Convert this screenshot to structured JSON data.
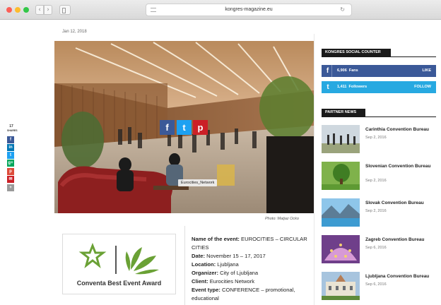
{
  "browser": {
    "url": "kongres-magazine.eu"
  },
  "left_share": {
    "count": "17",
    "count_label": "SHARES",
    "buttons": [
      "f",
      "in",
      "t",
      "g+",
      "p",
      "✉"
    ]
  },
  "article": {
    "date": "Jan 12, 2018",
    "image_tag": "Eurocities_Network",
    "photo_credit": "Photo: Matjaz Ocko",
    "share_buttons": [
      "f",
      "t",
      "p"
    ],
    "award": {
      "label": "Conventa Best Event Award"
    },
    "details": {
      "event_label": "Name of the event:",
      "event_value": " EUROCITIES – CIRCULAR CITIES",
      "date_label": "Date:",
      "date_value": " November 15 – 17, 2017",
      "location_label": "Location:",
      "location_value": " Ljubljana",
      "organizer_label": "Organizer:",
      "organizer_value": " City of Ljubljana",
      "client_label": "Client:",
      "client_value": " Eurocities Network",
      "type_label": "Event type:",
      "type_value": " CONFERENCE – promotional, educational"
    }
  },
  "sidebar": {
    "social_title": "KONGRES SOCIAL COUNTER",
    "facebook": {
      "count": "6,906",
      "unit": "Fans",
      "action": "LIKE"
    },
    "twitter": {
      "count": "1,411",
      "unit": "Followers",
      "action": "FOLLOW"
    },
    "partner_title": "PARTNER NEWS",
    "news": [
      {
        "title": "Carinthia Convention Bureau",
        "date": "Sep 2, 2016"
      },
      {
        "title": "Slovenian Convention Bureau",
        "date": "Sep 2, 2016"
      },
      {
        "title": "Slovak Convention Bureau",
        "date": "Sep 2, 2016"
      },
      {
        "title": "Zagreb Convention Bureau",
        "date": "Sep 6, 2016"
      },
      {
        "title": "Ljubljana Convention Bureau",
        "date": "Sep 6, 2016"
      }
    ]
  },
  "colors": {
    "facebook": "#3b5998",
    "twitter": "#1da1f2",
    "pinterest": "#cb2027",
    "award_green": "#5a9a2a"
  }
}
